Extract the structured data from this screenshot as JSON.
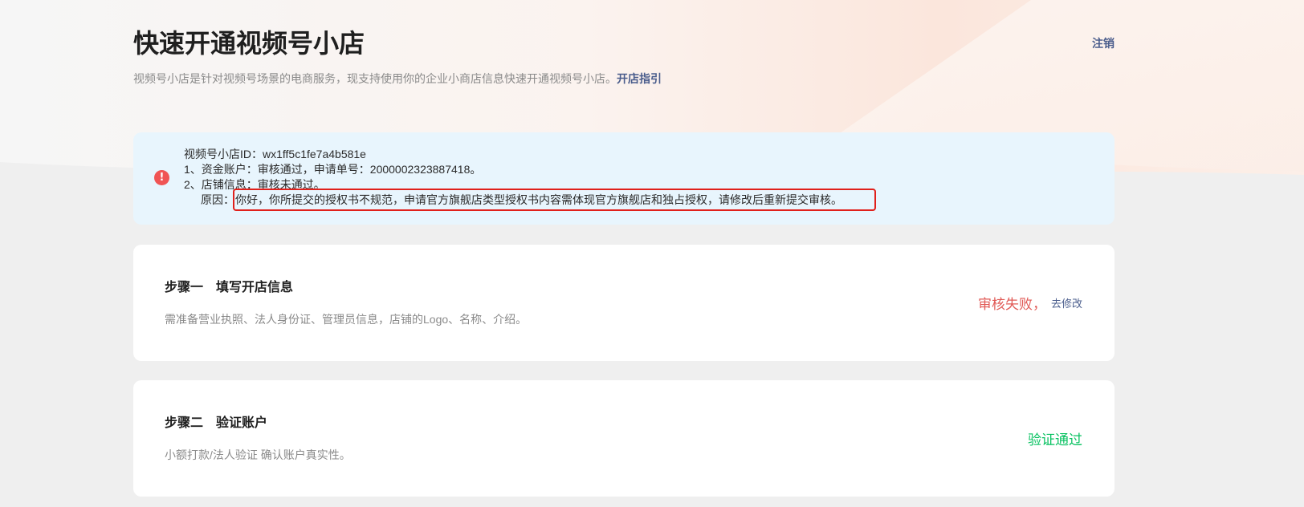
{
  "header": {
    "title": "快速开通视频号小店",
    "logout_label": "注销",
    "subtitle": "视频号小店是针对视频号场景的电商服务，现支持使用你的企业小商店信息快速开通视频号小店。",
    "guide_link": "开店指引"
  },
  "notice": {
    "icon": "exclamation-circle-icon",
    "icon_glyph": "!",
    "shop_id_line": "视频号小店ID：wx1ff5c1fe7a4b581e",
    "line1": "1、资金账户：审核通过，申请单号：2000002323887418。",
    "line2": "2、店铺信息：审核未通过。",
    "reason_label": "原因：",
    "reason_text": "你好，你所提交的授权书不规范，申请官方旗舰店类型授权书内容需体现官方旗舰店和独占授权，请修改后重新提交审核。"
  },
  "steps": [
    {
      "label": "步骤一",
      "title": "填写开店信息",
      "desc": "需准备营业执照、法人身份证、管理员信息，店铺的Logo、名称、介绍。",
      "status": "审核失败，",
      "action": "去修改"
    },
    {
      "label": "步骤二",
      "title": "验证账户",
      "desc": "小额打款/法人验证 确认账户真实性。",
      "status": "验证通过"
    }
  ],
  "colors": {
    "page_background": "#efefef",
    "notice_background": "#e8f5fd",
    "link": "#4a5d8c",
    "status_failed": "#e15a56",
    "status_passed": "#07c160",
    "notice_icon": "#f05454",
    "highlight_box": "#e0201b"
  }
}
